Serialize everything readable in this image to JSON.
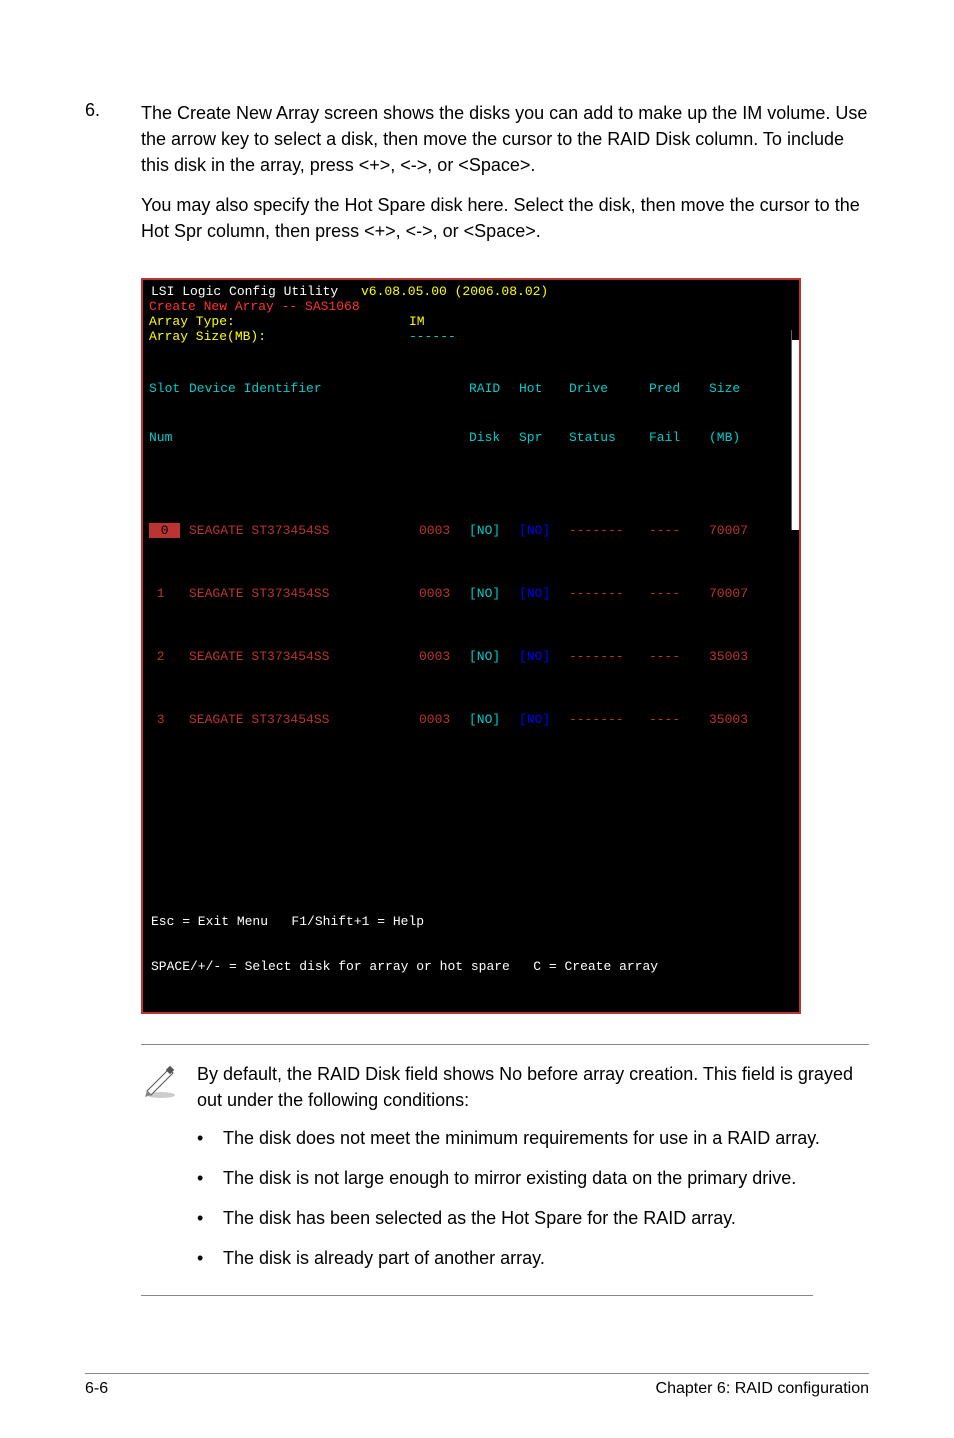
{
  "step": {
    "number": "6.",
    "para1": "The Create New Array screen shows the disks you can add to make up the IM volume. Use the arrow key to select a disk, then move the cursor to the RAID Disk column. To include this disk in the array, press <+>, <->, or <Space>.",
    "para2": "You may also specify the Hot Spare disk here. Select the disk, then move the cursor to the Hot Spr column, then press <+>, <->, or <Space>."
  },
  "bios": {
    "title_left": "LSI Logic Config Utility",
    "title_right": "v6.08.05.00 (2006.08.02)",
    "subtitle": "Create New Array -- SAS1068",
    "array_type_label": "Array Type:",
    "array_type_value": "IM",
    "array_size_label": "Array Size(MB):",
    "array_size_value": "------",
    "headers": {
      "slot": "Slot",
      "num": "Num",
      "dev": "Device Identifier",
      "raid1": "RAID",
      "raid2": "Disk",
      "hot1": "Hot",
      "hot2": "Spr",
      "drive1": "Drive",
      "drive2": "Status",
      "pred1": "Pred",
      "pred2": "Fail",
      "size1": "Size",
      "size2": "(MB)"
    },
    "rows": [
      {
        "slot": " 0 ",
        "dev": "SEAGATE ST373454SS",
        "id": "0003",
        "raid": "[NO]",
        "hot": "[NO]",
        "drive": "-------",
        "pred": "----",
        "size": "70007"
      },
      {
        "slot": " 1 ",
        "dev": "SEAGATE ST373454SS",
        "id": "0003",
        "raid": "[NO]",
        "hot": "[NO]",
        "drive": "-------",
        "pred": "----",
        "size": "70007"
      },
      {
        "slot": " 2 ",
        "dev": "SEAGATE ST373454SS",
        "id": "0003",
        "raid": "[NO]",
        "hot": "[NO]",
        "drive": "-------",
        "pred": "----",
        "size": "35003"
      },
      {
        "slot": " 3 ",
        "dev": "SEAGATE ST373454SS",
        "id": "0003",
        "raid": "[NO]",
        "hot": "[NO]",
        "drive": "-------",
        "pred": "----",
        "size": "35003"
      }
    ],
    "foot1": "Esc = Exit Menu   F1/Shift+1 = Help",
    "foot2": "SPACE/+/- = Select disk for array or hot spare   C = Create array"
  },
  "note": {
    "intro": "By default, the RAID Disk field shows No before array creation. This field is grayed out under the following conditions:",
    "bullets": [
      "The disk does not meet the  minimum requirements for use in a RAID array.",
      "The disk is not large enough to mirror existing data on the primary drive.",
      "The disk has been selected as the Hot Spare for the RAID array.",
      "The disk is already part of another array."
    ]
  },
  "footer": {
    "left": "6-6",
    "right": "Chapter 6: RAID configuration"
  }
}
